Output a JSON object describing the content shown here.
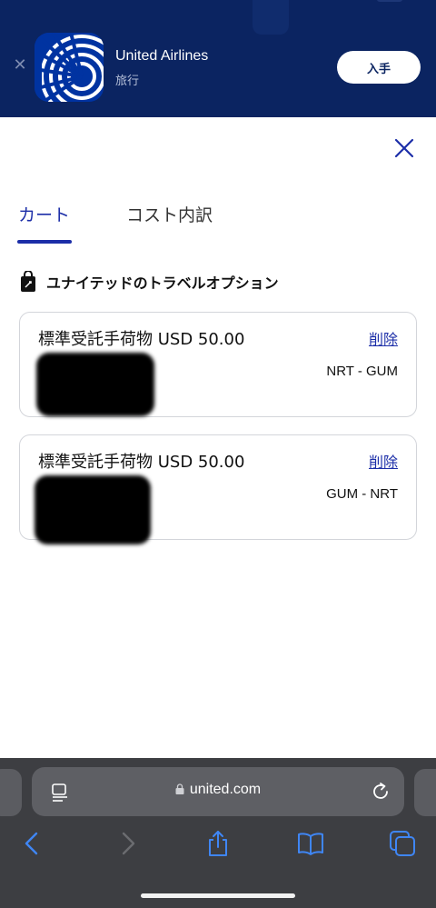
{
  "banner": {
    "close_icon": "close-icon",
    "app_name": "United Airlines",
    "category": "旅行",
    "get_label": "入手",
    "brand_color": "#0b2461"
  },
  "modal": {
    "close_icon": "close-icon",
    "tabs": [
      {
        "label": "カート",
        "active": true
      },
      {
        "label": "コスト内訳",
        "active": false
      }
    ],
    "section_icon": "shopping-bag-icon",
    "section_title": "ユナイテッドのトラベルオプション",
    "items": [
      {
        "title": "標準受託手荷物 USD 50.00",
        "delete_label": "削除",
        "route": "NRT - GUM"
      },
      {
        "title": "標準受託手荷物 USD 50.00",
        "delete_label": "削除",
        "route": "GUM - NRT"
      }
    ],
    "accent_color": "#1c2ea8"
  },
  "browser": {
    "url": "united.com",
    "reader_icon": "reader-mode-icon",
    "lock_icon": "lock-icon",
    "reload_icon": "reload-icon",
    "toolbar_icons": [
      "back-arrow-icon",
      "forward-arrow-icon",
      "share-icon",
      "bookmarks-icon",
      "tabs-icon"
    ]
  }
}
